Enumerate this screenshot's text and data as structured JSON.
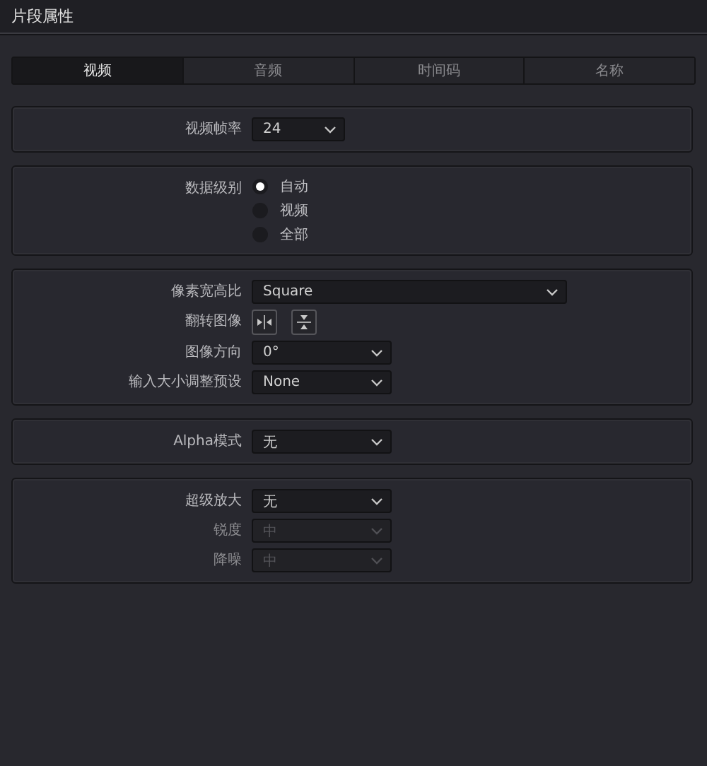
{
  "window": {
    "title": "片段属性"
  },
  "tabs": [
    {
      "label": "视频",
      "selected": true
    },
    {
      "label": "音频",
      "selected": false
    },
    {
      "label": "时间码",
      "selected": false
    },
    {
      "label": "名称",
      "selected": false
    }
  ],
  "panels": [
    {
      "rows": [
        {
          "kind": "short_dropdown",
          "label": "视频帧率",
          "value": "24",
          "disabled": false
        }
      ]
    },
    {
      "rows": [
        {
          "kind": "radio",
          "label": "数据级别",
          "options": [
            {
              "label": "自动",
              "selected": true
            },
            {
              "label": "视频",
              "selected": false
            },
            {
              "label": "全部",
              "selected": false
            }
          ]
        }
      ]
    },
    {
      "rows": [
        {
          "kind": "wide_dropdown",
          "label": "像素宽高比",
          "value": "Square",
          "disabled": false
        },
        {
          "kind": "flip",
          "label": "翻转图像"
        },
        {
          "kind": "dropdown",
          "label": "图像方向",
          "value": "0°",
          "disabled": false
        },
        {
          "kind": "dropdown",
          "label": "输入大小调整预设",
          "value": "None",
          "disabled": false
        }
      ]
    },
    {
      "rows": [
        {
          "kind": "dropdown",
          "label": "Alpha模式",
          "value": "无",
          "disabled": false
        }
      ]
    },
    {
      "rows": [
        {
          "kind": "dropdown",
          "label": "超级放大",
          "value": "无",
          "disabled": false
        },
        {
          "kind": "dropdown",
          "label": "锐度",
          "value": "中",
          "disabled": true
        },
        {
          "kind": "dropdown",
          "label": "降噪",
          "value": "中",
          "disabled": true
        }
      ]
    }
  ]
}
